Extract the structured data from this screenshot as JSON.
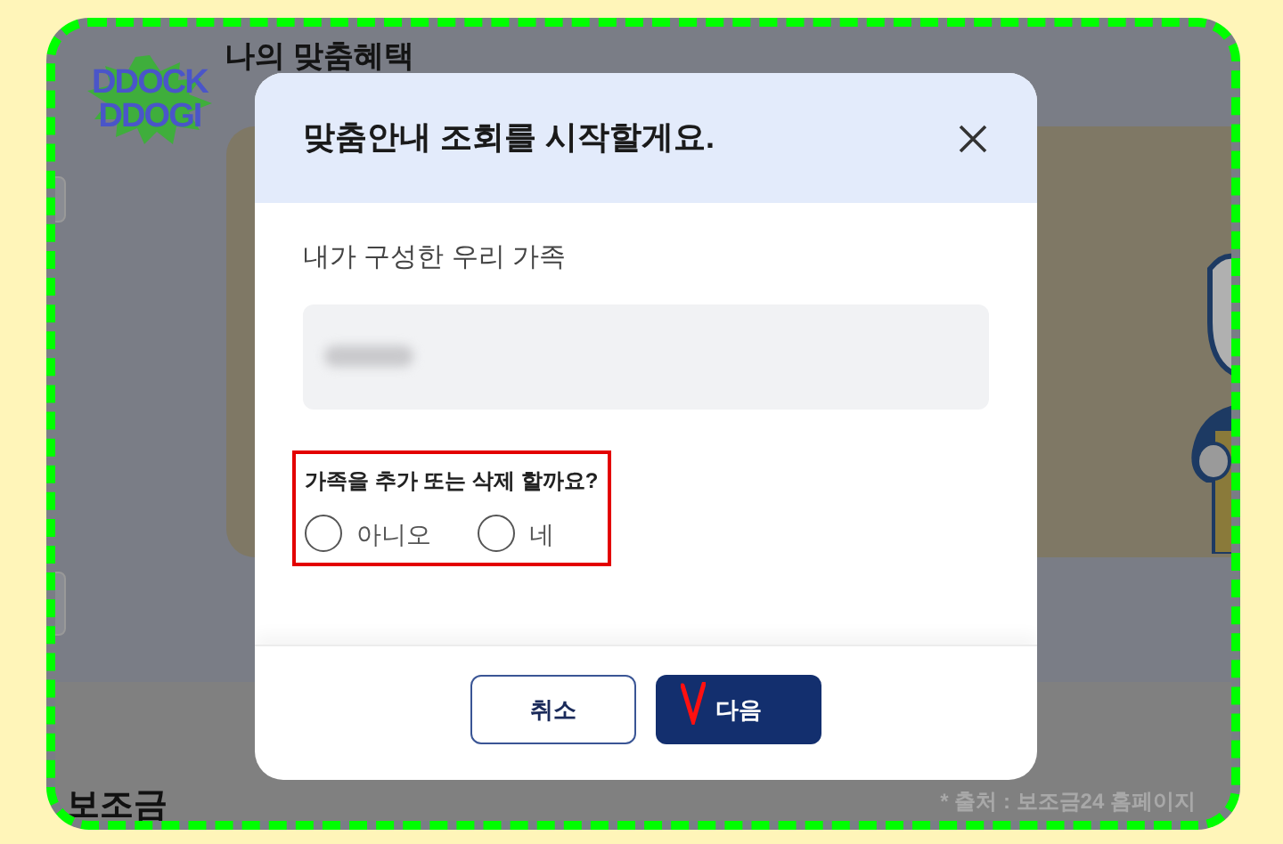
{
  "page": {
    "logo": {
      "line_1": "DDOCK",
      "line_2": "DDOGI"
    },
    "title": "나의 맞춤혜택",
    "section_label": "보조금",
    "source_note": "* 출처 : 보조금24 홈페이지"
  },
  "dialog": {
    "title": "맞춤안내 조회를 시작할게요.",
    "family_label": "내가 구성한 우리 가족",
    "question": "가족을 추가 또는 삭제 할까요?",
    "options": [
      {
        "label": "아니오",
        "selected": false
      },
      {
        "label": "네",
        "selected": false
      }
    ],
    "buttons": [
      {
        "label": "취소",
        "kind": "secondary"
      },
      {
        "label": "다음",
        "kind": "primary"
      }
    ]
  }
}
